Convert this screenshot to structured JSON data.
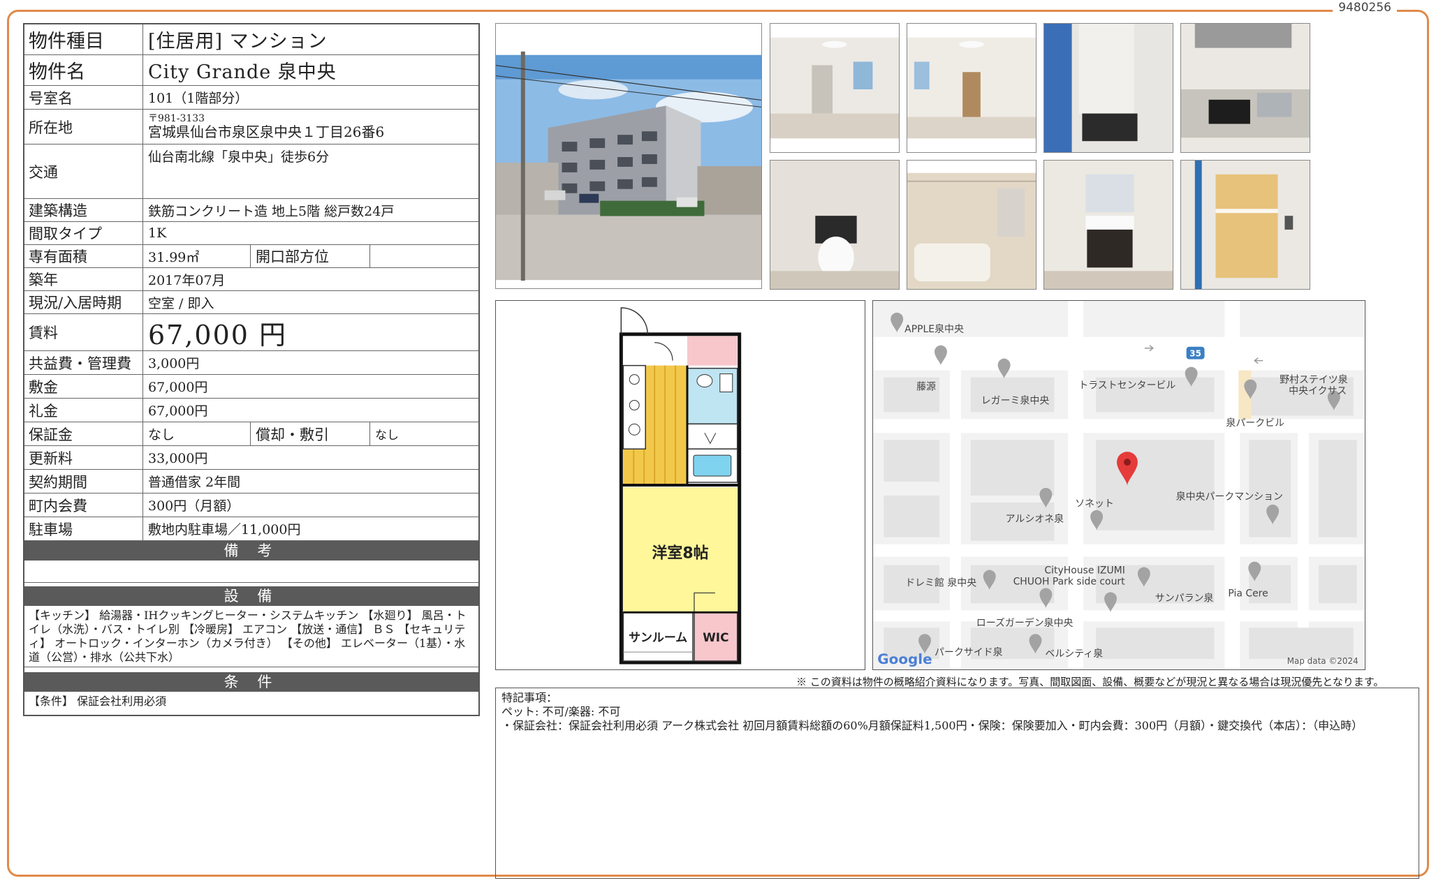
{
  "doc_id": "9480256",
  "property": {
    "type_label": "物件種目",
    "type_value": "[住居用] マンション",
    "name_label": "物件名",
    "name_value": "City Grande 泉中央",
    "room_label": "号室名",
    "room_value": "101（1階部分）",
    "address_label": "所在地",
    "postal_code": "〒981-3133",
    "address_value": "宮城県仙台市泉区泉中央１丁目26番6",
    "traffic_label": "交通",
    "traffic_value": "仙台南北線「泉中央」徒歩6分",
    "structure_label": "建築構造",
    "structure_value": "鉄筋コンクリート造 地上5階 総戸数24戸",
    "layout_label": "間取タイプ",
    "layout_value": "1K",
    "area_label": "専有面積",
    "area_value": "31.99㎡",
    "direction_label": "開口部方位",
    "direction_value": "",
    "built_label": "築年",
    "built_value": "2017年07月",
    "status_label": "現況/入居時期",
    "status_value": "空室 / 即入",
    "rent_label": "賃料",
    "rent_value": "67,000 円",
    "fee_label": "共益費・管理費",
    "fee_value": "3,000円",
    "deposit_label": "敷金",
    "deposit_value": "67,000円",
    "key_money_label": "礼金",
    "key_money_value": "67,000円",
    "guarantee_label": "保証金",
    "guarantee_value": "なし",
    "amort_label": "償却・敷引",
    "amort_value": "なし",
    "renewal_label": "更新料",
    "renewal_value": "33,000円",
    "contract_label": "契約期間",
    "contract_value": "普通借家 2年間",
    "town_fee_label": "町内会費",
    "town_fee_value": "300円（月額）",
    "parking_label": "駐車場",
    "parking_value": "敷地内駐車場／11,000円"
  },
  "sections": {
    "remarks_title": "備 考",
    "remarks_text": "",
    "equipment_title": "設 備",
    "equipment_text": "【キッチン】 給湯器・IHクッキングヒーター・システムキッチン 【水廻り】 風呂・トイレ（水洗）・バス・トイレ別 【冷暖房】 エアコン 【放送・通信】 ＢＳ 【セキュリティ】 オートロック・インターホン（カメラ付き） 【その他】 エレベーター（1基）・水道（公営）・排水（公共下水）",
    "conditions_title": "条 件",
    "conditions_text": "【条件】 保証会社利用必須"
  },
  "floorplan": {
    "room_label": "洋室8帖",
    "sunroom_label": "サンルーム",
    "wic_label": "WIC"
  },
  "map": {
    "road_number": "35",
    "labels": [
      "APPLE泉中央",
      "藤源",
      "レガーミ泉中央",
      "トラストセンタービル",
      "野村ステイツ泉",
      "中央イクサス",
      "泉パークビル",
      "ソネット",
      "アルシオネ泉",
      "泉中央パークマンション",
      "CityHouse IZUMI",
      "CHUOH Park side court",
      "ドレミ館 泉中央",
      "サンパラン泉",
      "Pia Cere",
      "ローズガーデン泉中央",
      "パークサイド泉",
      "ベルシティ泉"
    ],
    "google": "Google",
    "map_data": "Map data ©2024"
  },
  "note": "※ この資料は物件の概略紹介資料になります。写真、間取図面、設備、概要などが現況と異なる場合は現況優先となります。",
  "special": {
    "title": "特記事項：",
    "line1": "ペット: 不可/楽器: 不可",
    "line2": "・保証会社：保証会社利用必須 アーク株式会社 初回月額賃料総額の60%月額保証料1,500円・保険：保険要加入・町内会費：300円（月額）・鍵交換代（本店）：（申込時）"
  }
}
